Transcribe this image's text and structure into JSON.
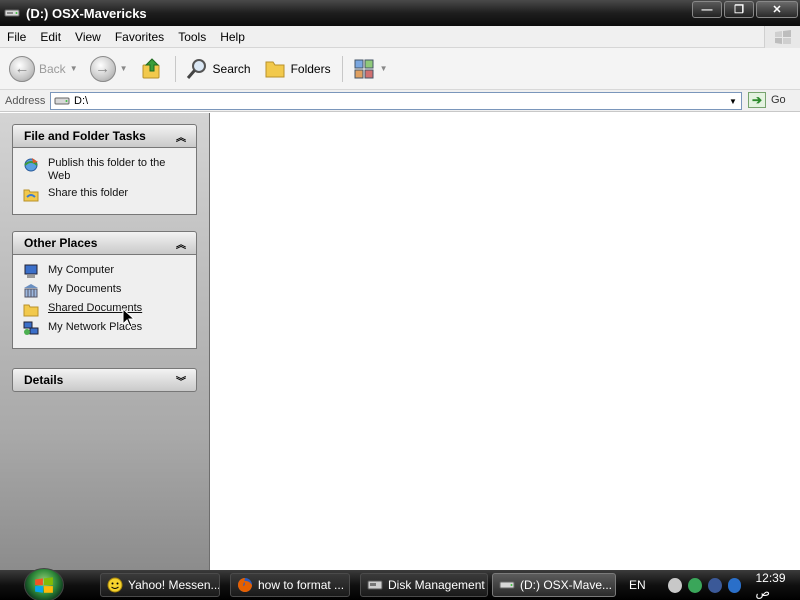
{
  "window": {
    "title": "(D:) OSX-Mavericks"
  },
  "menu": [
    "File",
    "Edit",
    "View",
    "Favorites",
    "Tools",
    "Help"
  ],
  "toolbar": {
    "back": "Back",
    "search": "Search",
    "folders": "Folders"
  },
  "address": {
    "label": "Address",
    "value": "D:\\",
    "go": "Go"
  },
  "left": {
    "tasks": {
      "title": "File and Folder Tasks",
      "items": [
        "Publish this folder to the Web",
        "Share this folder"
      ]
    },
    "places": {
      "title": "Other Places",
      "items": [
        "My Computer",
        "My Documents",
        "Shared Documents",
        "My Network Places"
      ]
    },
    "details": {
      "title": "Details"
    }
  },
  "taskbar": {
    "items": [
      "Yahoo! Messen...",
      "how to format ...",
      "Disk Management",
      "(D:) OSX-Mave..."
    ],
    "lang": "EN",
    "clock": "12:39 ص"
  }
}
